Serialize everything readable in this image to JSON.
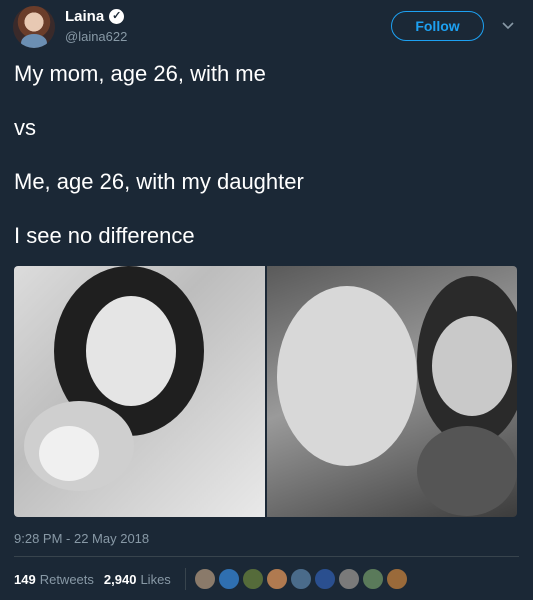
{
  "author": {
    "name": "Laina",
    "handle": "@laina622",
    "verified": true
  },
  "follow_label": "Follow",
  "tweet": {
    "lines": [
      "My mom, age 26, with me",
      "vs",
      "Me, age 26, with my daughter",
      "I see no difference"
    ]
  },
  "timestamp": "9:28 PM - 22 May 2018",
  "stats": {
    "retweets_count": "149",
    "retweets_label": "Retweets",
    "likes_count": "2,940",
    "likes_label": "Likes"
  },
  "likers": [
    "#8a7a6a",
    "#2f6fb0",
    "#556b3a",
    "#b07a50",
    "#4a6b8a",
    "#2a4f8f",
    "#7a7a7a",
    "#5a7a5a",
    "#9a6a3a"
  ],
  "colors": {
    "background": "#1b2836",
    "accent": "#1da1f2",
    "muted": "#8899a6",
    "divider": "#38444d"
  }
}
